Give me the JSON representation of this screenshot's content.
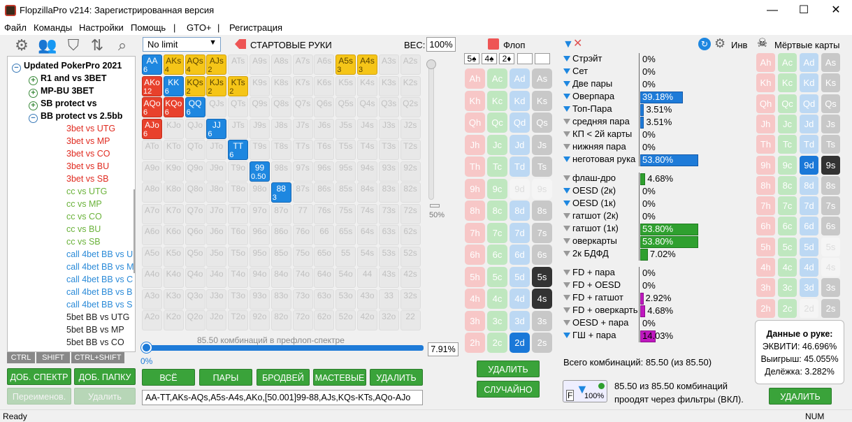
{
  "window": {
    "title": "FlopzillaPro v214: Зарегистрированная версия",
    "minimize": "—",
    "maximize": "☐",
    "close": "✕"
  },
  "menu": [
    "Файл",
    "Команды",
    "Настройки",
    "Помощь",
    "|",
    "GTO+",
    "|",
    "Регистрация"
  ],
  "tree": {
    "root": "Updated PokerPro 2021",
    "nodes": [
      {
        "label": "R1 and vs 3BET",
        "state": "plus",
        "bold": true
      },
      {
        "label": "MP-BU 3BET",
        "state": "plus",
        "bold": true
      },
      {
        "label": "SB protect vs",
        "state": "plus",
        "bold": true
      },
      {
        "label": "BB protect vs 2.5bb",
        "state": "minus",
        "bold": true
      }
    ],
    "leaves": [
      {
        "label": "3bet vs UTG",
        "color": "#e02b20"
      },
      {
        "label": "3bet vs MP",
        "color": "#e02b20"
      },
      {
        "label": "3bet vs CO",
        "color": "#e02b20"
      },
      {
        "label": "3bet vs BU",
        "color": "#e02b20"
      },
      {
        "label": "3bet vs SB",
        "color": "#e02b20"
      },
      {
        "label": "cc vs UTG",
        "color": "#6ab23a"
      },
      {
        "label": "cc vs MP",
        "color": "#6ab23a"
      },
      {
        "label": "cc vs CO",
        "color": "#6ab23a"
      },
      {
        "label": "cc vs BU",
        "color": "#6ab23a"
      },
      {
        "label": "cc vs SB",
        "color": "#6ab23a"
      },
      {
        "label": "call 4bet BB vs U",
        "color": "#2a8ad8"
      },
      {
        "label": "call 4bet BB vs M",
        "color": "#2a8ad8"
      },
      {
        "label": "call 4bet BB vs C",
        "color": "#2a8ad8"
      },
      {
        "label": "call 4bet BB vs B",
        "color": "#2a8ad8"
      },
      {
        "label": "call 4bet BB vs S",
        "color": "#2a8ad8"
      },
      {
        "label": "5bet BB vs UTG",
        "color": "#222222"
      },
      {
        "label": "5bet BB vs MP",
        "color": "#222222"
      },
      {
        "label": "5bet BB vs CO",
        "color": "#222222"
      }
    ]
  },
  "keys": {
    "ctrl": "CTRL",
    "shift": "SHIFT",
    "ctrlshift": "CTRL+SHIFT"
  },
  "left_buttons": {
    "add_range": "ДОБ. СПЕКТР",
    "add_folder": "ДОБ. ПАПКУ",
    "rename": "Переименов.",
    "delete": "Удалить"
  },
  "range": {
    "limit": "No limit",
    "header": "СТАРТОВЫЕ РУКИ",
    "weight_label": "ВЕС:",
    "weight_value": "100%",
    "slider_pct": "50%",
    "combos_text": "85.50 комбинаций в префлоп-спектре",
    "range_pct": "7.91%",
    "hslider_pct": "0%",
    "range_string": "AA-TT,AKs-AQs,A5s-A4s,AKo,[50.001]99-88,AJs,KQs-KTs,AQo-AJo",
    "buttons": {
      "all": "ВСЁ",
      "pairs": "ПАРЫ",
      "broadway": "БРОДВЕЙ",
      "suited": "МАСТЕВЫЕ",
      "delete": "УДАЛИТЬ"
    }
  },
  "grid": [
    [
      "AA|6|y2",
      "AKs|4|y",
      "AQs|4|y",
      "AJs|2|y",
      "ATs",
      "A9s",
      "A8s",
      "A7s",
      "A6s",
      "A5s|3|y",
      "A4s|3|y",
      "A3s",
      "A2s"
    ],
    [
      "AKo|12|r",
      "KK|6|b",
      "KQs|2|y",
      "KJs|2|y",
      "KTs|2|y",
      "K9s",
      "K8s",
      "K7s",
      "K6s",
      "K5s",
      "K4s",
      "K3s",
      "K2s"
    ],
    [
      "AQo|6|r",
      "KQo|6|r",
      "QQ|6|b",
      "QJs",
      "QTs",
      "Q9s",
      "Q8s",
      "Q7s",
      "Q6s",
      "Q5s",
      "Q4s",
      "Q3s",
      "Q2s"
    ],
    [
      "AJo|6|r",
      "KJo",
      "QJo",
      "JJ|6|b",
      "JTs",
      "J9s",
      "J8s",
      "J7s",
      "J6s",
      "J5s",
      "J4s",
      "J3s",
      "J2s"
    ],
    [
      "ATo",
      "KTo",
      "QTo",
      "JTo",
      "TT|6|b",
      "T9s",
      "T8s",
      "T7s",
      "T6s",
      "T5s",
      "T4s",
      "T3s",
      "T2s"
    ],
    [
      "A9o",
      "K9o",
      "Q9o",
      "J9o",
      "T9o",
      "99|0.50|b",
      "98s",
      "97s",
      "96s",
      "95s",
      "94s",
      "93s",
      "92s"
    ],
    [
      "A8o",
      "K8o",
      "Q8o",
      "J8o",
      "T8o",
      "98o",
      "88|3|b",
      "87s",
      "86s",
      "85s",
      "84s",
      "83s",
      "82s"
    ],
    [
      "A7o",
      "K7o",
      "Q7o",
      "J7o",
      "T7o",
      "97o",
      "87o",
      "77",
      "76s",
      "75s",
      "74s",
      "73s",
      "72s"
    ],
    [
      "A6o",
      "K6o",
      "Q6o",
      "J6o",
      "T6o",
      "96o",
      "86o",
      "76o",
      "66",
      "65s",
      "64s",
      "63s",
      "62s"
    ],
    [
      "A5o",
      "K5o",
      "Q5o",
      "J5o",
      "T5o",
      "95o",
      "85o",
      "75o",
      "65o",
      "55",
      "54s",
      "53s",
      "52s"
    ],
    [
      "A4o",
      "K4o",
      "Q4o",
      "J4o",
      "T4o",
      "94o",
      "84o",
      "74o",
      "64o",
      "54o",
      "44",
      "43s",
      "42s"
    ],
    [
      "A3o",
      "K3o",
      "Q3o",
      "J3o",
      "T3o",
      "93o",
      "83o",
      "73o",
      "63o",
      "53o",
      "43o",
      "33",
      "32s"
    ],
    [
      "A2o",
      "K2o",
      "Q2o",
      "J2o",
      "T2o",
      "92o",
      "82o",
      "72o",
      "62o",
      "52o",
      "42o",
      "32o",
      "22"
    ]
  ],
  "flop": {
    "header": "Флоп",
    "slots": [
      "5♠",
      "4♠",
      "2♦",
      "",
      ""
    ],
    "ranks": [
      "A",
      "K",
      "Q",
      "J",
      "T",
      "9",
      "8",
      "7",
      "6",
      "5",
      "4",
      "3",
      "2"
    ],
    "selected": {
      "5s": "selS",
      "4s": "selS",
      "2d": "selD"
    },
    "dead": [
      "9d",
      "9s",
      "5s",
      "4s",
      "2d"
    ],
    "delete": "УДАЛИТЬ",
    "random": "СЛУЧАЙНО"
  },
  "stats": {
    "made": [
      {
        "label": "Стрэйт",
        "value": "0%",
        "pct": 0,
        "f": "b"
      },
      {
        "label": "Сет",
        "value": "0%",
        "pct": 0,
        "f": "b"
      },
      {
        "label": "Две пары",
        "value": "0%",
        "pct": 0,
        "f": "b"
      },
      {
        "label": "Оверпара",
        "value": "39.18%",
        "pct": 39.18,
        "f": "b",
        "bar": "b-blue"
      },
      {
        "label": "Топ-Пара",
        "value": "3.51%",
        "pct": 3.51,
        "f": "b",
        "bar": "b-blue"
      },
      {
        "label": "средняя пара",
        "value": "3.51%",
        "pct": 3.51,
        "f": "g",
        "bar": "b-blue"
      },
      {
        "label": "КП < 2й карты",
        "value": "0%",
        "pct": 0,
        "f": "g"
      },
      {
        "label": "нижняя пара",
        "value": "0%",
        "pct": 0,
        "f": "g"
      },
      {
        "label": "неготовая рука",
        "value": "53.80%",
        "pct": 53.8,
        "f": "b",
        "bar": "b-blue"
      }
    ],
    "draws": [
      {
        "label": "флаш-дро",
        "value": "4.68%",
        "pct": 4.68,
        "f": "g",
        "bar": "b-green"
      },
      {
        "label": "OESD (2к)",
        "value": "0%",
        "pct": 0,
        "f": "b"
      },
      {
        "label": "OESD (1к)",
        "value": "0%",
        "pct": 0,
        "f": "b"
      },
      {
        "label": "гатшот (2к)",
        "value": "0%",
        "pct": 0,
        "f": "g"
      },
      {
        "label": "гатшот (1к)",
        "value": "53.80%",
        "pct": 53.8,
        "f": "g",
        "bar": "b-green"
      },
      {
        "label": "оверкарты",
        "value": "53.80%",
        "pct": 53.8,
        "f": "g",
        "bar": "b-green"
      },
      {
        "label": "2к БДФД",
        "value": "7.02%",
        "pct": 7.02,
        "f": "g",
        "bar": "b-green"
      }
    ],
    "combos": [
      {
        "label": "FD + пара",
        "value": "0%",
        "pct": 0,
        "f": "g"
      },
      {
        "label": "FD + OESD",
        "value": "0%",
        "pct": 0,
        "f": "g"
      },
      {
        "label": "FD + гатшот",
        "value": "2.92%",
        "pct": 2.92,
        "f": "g",
        "bar": "b-mag"
      },
      {
        "label": "FD + оверкарть",
        "value": "4.68%",
        "pct": 4.68,
        "f": "g",
        "bar": "b-mag"
      },
      {
        "label": "OESD + пара",
        "value": "0%",
        "pct": 0,
        "f": "g"
      },
      {
        "label": "ГШ + пара",
        "value": "14.03%",
        "pct": 14.03,
        "f": "b",
        "bar": "b-mag"
      }
    ],
    "total": "Всего комбинаций: 85.50 (из 85.50)",
    "filter_pct": "100%",
    "filter_text_1": "85.50 из 85.50 комбинаций",
    "filter_text_2": "проодят через фильтры (ВКЛ).",
    "inv_label": "Инв"
  },
  "dead_cards": {
    "header": "Мёртвые карты",
    "selected": {
      "9d": "selD",
      "9s": "selS"
    },
    "dead": [
      "5s",
      "4s",
      "2d"
    ],
    "delete": "УДАЛИТЬ"
  },
  "hand_data": {
    "title": "Данные о руке:",
    "equity": "ЭКВИТИ: 46.696%",
    "win": "Выигрыш: 45.055%",
    "tie": "Делёжка: 3.282%"
  },
  "status": {
    "ready": "Ready",
    "num": "NUM"
  }
}
